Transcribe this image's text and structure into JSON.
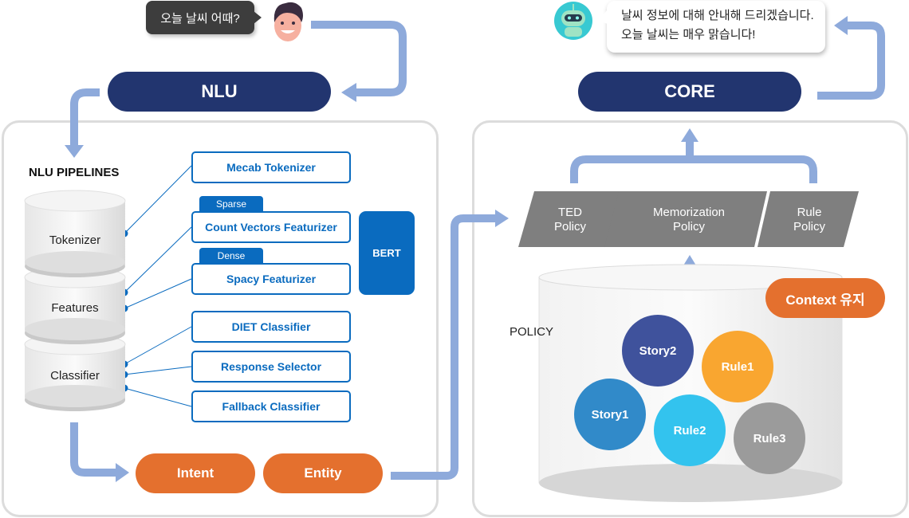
{
  "user_bubble": {
    "text": "오늘 날씨 어때?",
    "icon": "user-face-icon"
  },
  "bot_bubble": {
    "line1": "날씨 정보에 대해 안내해 드리겠습니다.",
    "line2": "오늘 날씨는 매우 맑습니다!",
    "icon": "robot-icon"
  },
  "nlu": {
    "title": "NLU",
    "pipelines_heading": "NLU PIPELINES",
    "layers": [
      "Tokenizer",
      "Features",
      "Classifier"
    ],
    "components": {
      "mecab": "Mecab Tokenizer",
      "count_vectors": "Count Vectors Featurizer",
      "spacy": "Spacy Featurizer",
      "diet": "DIET Classifier",
      "response_selector": "Response Selector",
      "fallback": "Fallback Classifier"
    },
    "tags": {
      "sparse": "Sparse",
      "dense": "Dense"
    },
    "bert": "BERT",
    "outputs": {
      "intent": "Intent",
      "entity": "Entity"
    }
  },
  "core": {
    "title": "CORE",
    "policies": [
      {
        "line1": "TED",
        "line2": "Policy"
      },
      {
        "line1": "Memorization",
        "line2": "Policy"
      },
      {
        "line1": "Rule",
        "line2": "Policy"
      }
    ],
    "policy_label": "POLICY",
    "context_badge": "Context 유지",
    "items": [
      "Story2",
      "Rule1",
      "Story1",
      "Rule2",
      "Rule3"
    ]
  },
  "colors": {
    "navy": "#22356f",
    "orange": "#e4702e",
    "blue": "#0a6bbf",
    "arrow": "#8eaadb",
    "policy_gray": "#7f7f7f",
    "story2": "#3f529c",
    "rule1": "#f9a630",
    "story1": "#318ac9",
    "rule2": "#33c3ee",
    "rule3": "#9b9b9b"
  }
}
